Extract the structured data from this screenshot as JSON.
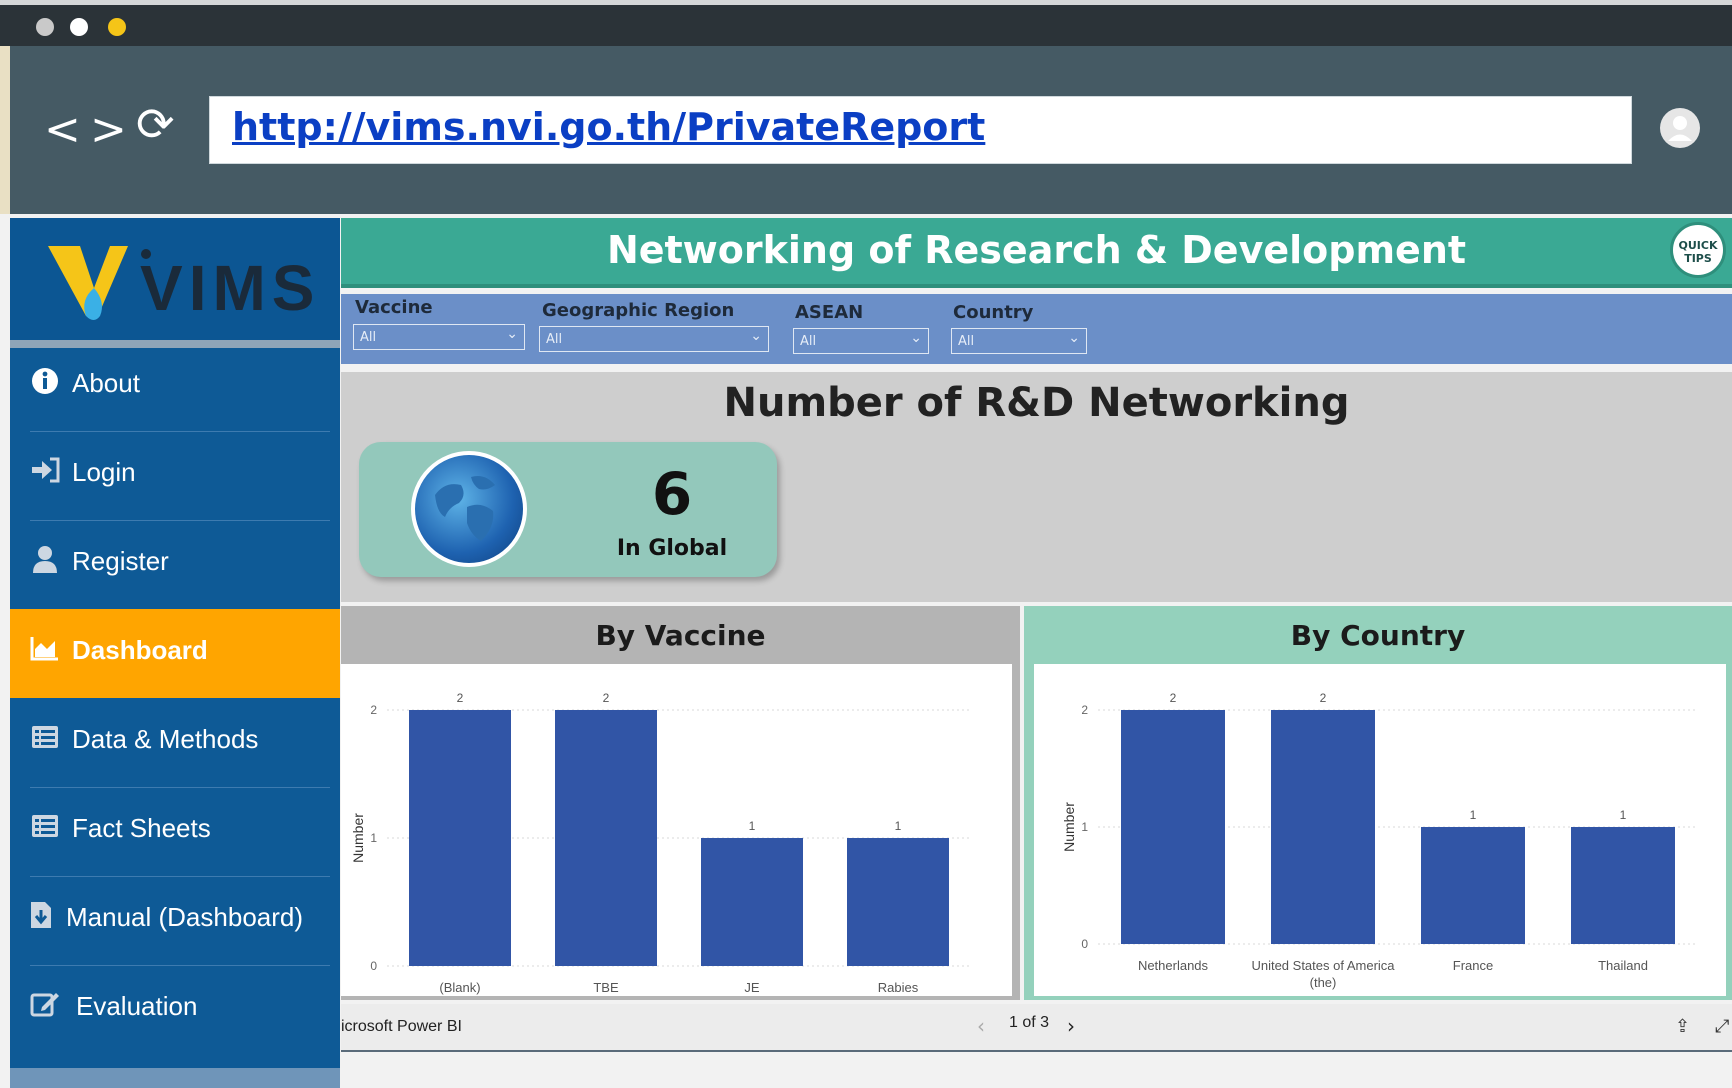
{
  "browser": {
    "url": "http://vims.nvi.go.th/PrivateReport",
    "back_icon": "<",
    "forward_icon": ">",
    "reload_icon": "⟳"
  },
  "sidebar": {
    "logo_text": "VIMS",
    "items": [
      {
        "label": "About",
        "icon": "info-icon"
      },
      {
        "label": "Login",
        "icon": "login-icon"
      },
      {
        "label": "Register",
        "icon": "user-icon"
      },
      {
        "label": "Dashboard",
        "icon": "chart-icon",
        "active": true
      },
      {
        "label": "Data & Methods",
        "icon": "list-icon"
      },
      {
        "label": "Fact Sheets",
        "icon": "list-icon"
      },
      {
        "label": "Manual (Dashboard)",
        "icon": "download-icon"
      },
      {
        "label": "Evaluation",
        "icon": "edit-icon"
      }
    ]
  },
  "report": {
    "title": "Networking of Research & Development",
    "quick_tips": "QUICK TIPS",
    "filters": [
      {
        "label": "Vaccine",
        "value": "All"
      },
      {
        "label": "Geographic Region",
        "value": "All"
      },
      {
        "label": "ASEAN",
        "value": "All"
      },
      {
        "label": "Country",
        "value": "All"
      }
    ],
    "kpi": {
      "title": "Number of R&D Networking",
      "value": "6",
      "subtitle": "In Global"
    },
    "footer": {
      "brand": "icrosoft Power BI",
      "page": "1 of 3"
    }
  },
  "chart_data": [
    {
      "type": "bar",
      "title": "By Vaccine",
      "categories": [
        "(Blank)",
        "TBE",
        "JE",
        "Rabies"
      ],
      "values": [
        2,
        2,
        1,
        1
      ],
      "ylabel": "Number",
      "ylim": [
        0,
        2
      ],
      "yticks": [
        "0",
        "1",
        "2"
      ],
      "color": "#3155a6"
    },
    {
      "type": "bar",
      "title": "By Country",
      "categories": [
        "Netherlands",
        "United States of America (the)",
        "France",
        "Thailand"
      ],
      "values": [
        2,
        2,
        1,
        1
      ],
      "ylabel": "Number",
      "ylim": [
        0,
        2
      ],
      "yticks": [
        "0",
        "1",
        "2"
      ],
      "color": "#3155a6"
    }
  ],
  "colors": {
    "header": "#3aa994",
    "filters": "#6b8fc8",
    "sidebar": "#0e5a96",
    "active": "#ffa500"
  }
}
